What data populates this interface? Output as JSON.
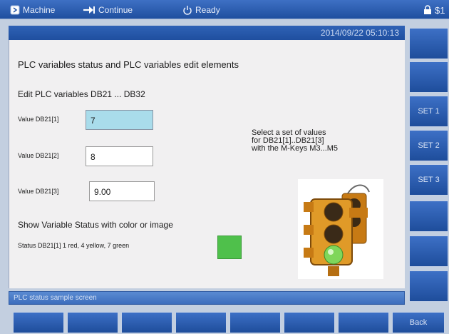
{
  "titlebar": {
    "machine_label": "Machine",
    "continue_label": "Continue",
    "ready_label": "Ready",
    "channel_label": "$1"
  },
  "datetime": "2014/09/22  05:10:13",
  "content": {
    "heading": "PLC variables status and PLC variables edit elements",
    "subheading": "Edit PLC variables DB21 ... DB32",
    "fields": [
      {
        "label": "Value DB21[1]",
        "value": "7"
      },
      {
        "label": "Value DB21[2]",
        "value": "8"
      },
      {
        "label": "Value DB21[3]",
        "value": "9.00"
      }
    ],
    "instruction_lines": [
      "Select a set of values",
      "for DB21[1]..DB21[3]",
      "with the M-Keys M3...M5"
    ],
    "status_heading": "Show Variable Status with color or image",
    "status_text": "Status DB21[1] 1 red, 4 yellow, 7 green",
    "status_color": "#4fc04b"
  },
  "statusbar": {
    "text": "PLC status sample screen"
  },
  "softkeys_vertical": [
    "",
    "",
    "SET 1",
    "SET 2",
    "SET 3",
    "",
    "",
    ""
  ],
  "softkeys_horizontal": [
    "",
    "",
    "",
    "",
    "",
    "",
    "",
    "Back"
  ],
  "colors": {
    "accent": "#2a5aa8",
    "panel": "#f1f0f1",
    "focus": "#a9dceb"
  }
}
